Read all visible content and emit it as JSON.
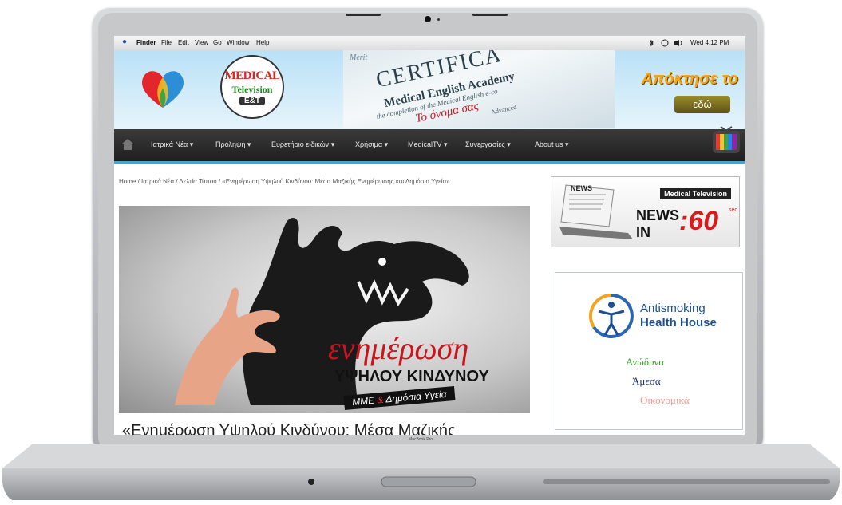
{
  "menubar": {
    "apple": "",
    "items": [
      "Finder",
      "File",
      "Edit",
      "View",
      "Go",
      "Window",
      "Help"
    ],
    "clock": "Wed 4:12 PM"
  },
  "header": {
    "badge": {
      "line1": "MEDICAL",
      "line2": "Television",
      "line3": "E&T"
    },
    "certificate": {
      "title": "CERTIFICA",
      "academy": "Medical English Academy",
      "line3": "the completion of the Medical English e-co",
      "name": "Το όνομα σας",
      "line5": "Advanced",
      "corner": "Merit"
    },
    "promo": {
      "headline": "Απόκτησε το",
      "button": "εδώ"
    }
  },
  "nav": {
    "items": [
      "Ιατρικά Νέα",
      "Πρόληψη",
      "Ευρετήριο ειδικών",
      "Χρήσιμα",
      "MedicalTV",
      "Συνεργασίες",
      "About us"
    ]
  },
  "breadcrumb": "Home / Ιατρικά Νέα / Δελτία Τύπου / «Ενημέρωση Υψηλού Κινδύνου: Μέσα Μαζικής Ενημέρωσης και Δημόσια Υγεία»",
  "hero": {
    "word1": "ενημέρωση",
    "word2": "ΥΨΗΛΟΥ ΚΙΝΔΥΝΟΥ",
    "tag_a": "ΜΜΕ",
    "tag_amp": "&",
    "tag_b": "Δημόσια Υγεία"
  },
  "article": {
    "title": "«Ενημέρωση Υψηλού Κινδύνου: Μέσα Μαζικής"
  },
  "sidebar": {
    "news": {
      "paper": "NEWS",
      "label": "Medical Television",
      "news": "NEWS",
      "in": "IN",
      "sixty": ":60",
      "sec": "sec"
    },
    "antismoking": {
      "line1": "Antismoking",
      "line2": "Health House",
      "w1": "Ανώδυνα",
      "w2": "Άμεσα",
      "w3": "Οικονομικά"
    }
  },
  "laptop": {
    "brand": "MacBook Pro"
  },
  "colors": {
    "nav_bg": "#2a2a2a",
    "accent": "#4aa3d8",
    "hero_red": "#c6161f",
    "promo_orange": "#f4a60f"
  }
}
